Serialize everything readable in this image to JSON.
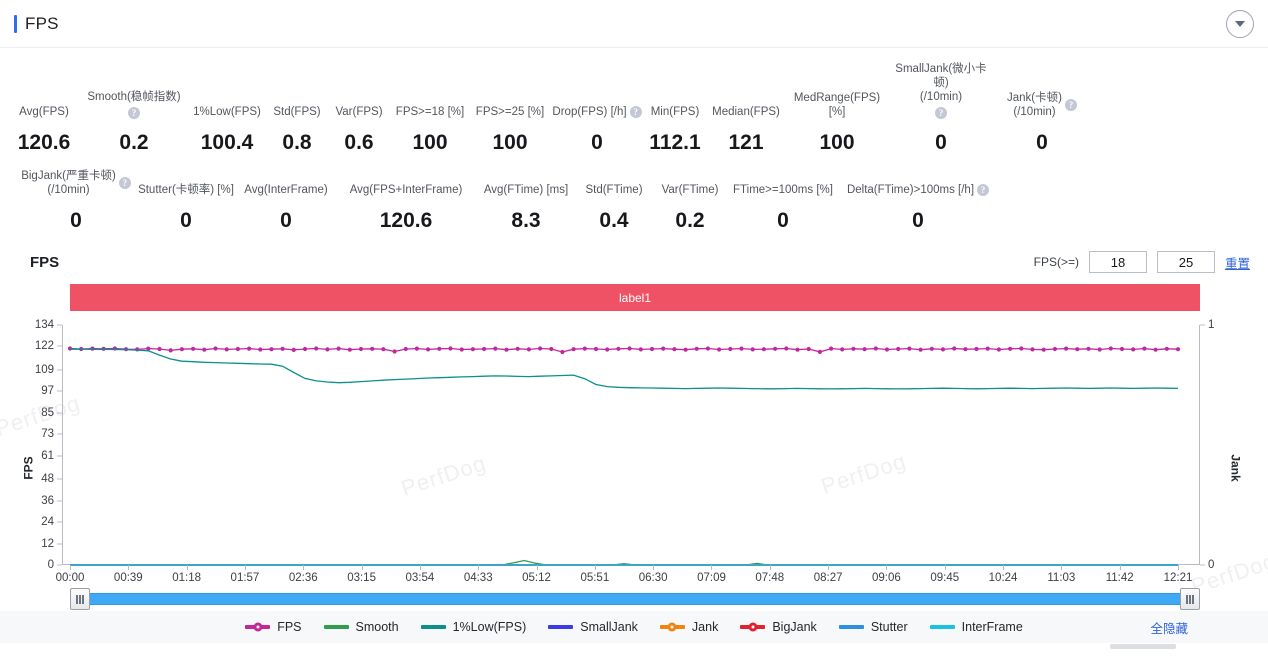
{
  "header": {
    "title": "FPS",
    "collapse_icon": "chevron-down-icon",
    "accent_color": "#2f6fe4"
  },
  "watermark": "PerfDog",
  "metrics_rows": [
    [
      {
        "label": "Avg(FPS)",
        "value": "120.6",
        "help": false
      },
      {
        "label": "Smooth(稳帧指数)",
        "value": "0.2",
        "help": true
      },
      {
        "label": "1%Low(FPS)",
        "value": "100.4",
        "help": false
      },
      {
        "label": "Std(FPS)",
        "value": "0.8",
        "help": false
      },
      {
        "label": "Var(FPS)",
        "value": "0.6",
        "help": false
      },
      {
        "label": "FPS>=18 [%]",
        "value": "100",
        "help": false
      },
      {
        "label": "FPS>=25 [%]",
        "value": "100",
        "help": false
      },
      {
        "label": "Drop(FPS) [/h]",
        "value": "0",
        "help": true
      },
      {
        "label": "Min(FPS)",
        "value": "112.1",
        "help": false
      },
      {
        "label": "Median(FPS)",
        "value": "121",
        "help": false
      },
      {
        "label": "MedRange(FPS)[%]",
        "value": "100",
        "help": false
      },
      {
        "label": "SmallJank(微小卡顿)\n(/10min)",
        "value": "0",
        "help": true
      },
      {
        "label": "Jank(卡顿)\n(/10min)",
        "value": "0",
        "help": true
      }
    ],
    [
      {
        "label": "BigJank(严重卡顿)\n(/10min)",
        "value": "0",
        "help": true
      },
      {
        "label": "Stutter(卡顿率) [%]",
        "value": "0",
        "help": false
      },
      {
        "label": "Avg(InterFrame)",
        "value": "0",
        "help": false
      },
      {
        "label": "Avg(FPS+InterFrame)",
        "value": "120.6",
        "help": false
      },
      {
        "label": "Avg(FTime) [ms]",
        "value": "8.3",
        "help": false
      },
      {
        "label": "Std(FTime)",
        "value": "0.4",
        "help": false
      },
      {
        "label": "Var(FTime)",
        "value": "0.2",
        "help": false
      },
      {
        "label": "FTime>=100ms [%]",
        "value": "0",
        "help": false
      },
      {
        "label": "Delta(FTime)>100ms [/h]",
        "value": "0",
        "help": true
      }
    ]
  ],
  "chart_section": {
    "heading": "FPS",
    "controls": {
      "label": "FPS(>=)",
      "threshold_1": "18",
      "threshold_2": "25",
      "reset_label": "重置"
    },
    "label_bar": "label1",
    "datazoom": {
      "start_percent": 0,
      "end_percent": 100
    }
  },
  "chart_data": {
    "type": "line",
    "title": "FPS",
    "xlabel": "",
    "ylabel": "FPS",
    "y2label": "Jank",
    "grid": false,
    "legend_position": "bottom",
    "annotation_bar": "label1",
    "x_ticks": [
      "00:00",
      "00:39",
      "01:18",
      "01:57",
      "02:36",
      "03:15",
      "03:54",
      "04:33",
      "05:12",
      "05:51",
      "06:30",
      "07:09",
      "07:48",
      "08:27",
      "09:06",
      "09:45",
      "10:24",
      "11:03",
      "11:42",
      "12:21"
    ],
    "y_ticks": [
      0,
      12,
      24,
      36,
      48,
      61,
      73,
      85,
      97,
      109,
      122,
      134
    ],
    "ylim": [
      0,
      134
    ],
    "y2_ticks": [
      0,
      1
    ],
    "y2lim": [
      0,
      1
    ],
    "series": [
      {
        "name": "FPS",
        "color": "#c2279b",
        "axis": "left",
        "marker": "circle",
        "values": [
          120.9,
          120.6,
          120.8,
          120.7,
          120.9,
          120.5,
          120.4,
          120.8,
          120.6,
          119.8,
          120.5,
          120.7,
          120.2,
          120.9,
          120.4,
          120.6,
          120.8,
          120.3,
          120.5,
          120.7,
          120.1,
          120.6,
          120.9,
          120.4,
          120.8,
          120.2,
          120.6,
          120.7,
          120.5,
          119.2,
          120.6,
          120.8,
          120.4,
          120.7,
          120.9,
          120.3,
          120.5,
          120.6,
          120.8,
          120.2,
          120.7,
          120.4,
          120.9,
          120.6,
          118.9,
          120.5,
          120.8,
          120.6,
          120.3,
          120.7,
          120.9,
          120.4,
          120.6,
          120.8,
          120.5,
          120.2,
          120.7,
          120.9,
          120.3,
          120.6,
          120.8,
          120.4,
          120.5,
          120.7,
          120.9,
          120.2,
          120.6,
          119.0,
          120.8,
          120.4,
          120.7,
          120.5,
          120.9,
          120.3,
          120.6,
          120.8,
          120.2,
          120.7,
          120.4,
          120.9,
          120.5,
          120.6,
          120.8,
          120.3,
          120.7,
          120.9,
          120.4,
          120.2,
          120.6,
          120.8,
          120.5,
          120.7,
          120.3,
          120.9,
          120.6,
          120.4,
          120.8,
          120.2,
          120.7,
          120.5
        ]
      },
      {
        "name": "Smooth",
        "color": "#2f9e4f",
        "axis": "left",
        "values": [
          0,
          0,
          0,
          0,
          0,
          0,
          0,
          0,
          0,
          0,
          0,
          0,
          0,
          0,
          0,
          0,
          0,
          0,
          0,
          0,
          0,
          0,
          0,
          0,
          0,
          0,
          0,
          0,
          0,
          0,
          0,
          0,
          0,
          0,
          0,
          0,
          0,
          0,
          0,
          0,
          1.2,
          2.5,
          1.0,
          0,
          0,
          0,
          0,
          0,
          0,
          0,
          0.8,
          0,
          0,
          0,
          0,
          0,
          0,
          0,
          0,
          0,
          0,
          0,
          0.9,
          0,
          0,
          0,
          0,
          0,
          0,
          0,
          0,
          0,
          0,
          0,
          0,
          0,
          0,
          0,
          0,
          0,
          0,
          0,
          0,
          0,
          0,
          0,
          0,
          0,
          0,
          0,
          0,
          0,
          0,
          0,
          0,
          0,
          0,
          0,
          0,
          0,
          0
        ]
      },
      {
        "name": "1%Low(FPS)",
        "color": "#0b8f8f",
        "axis": "left",
        "values": [
          120.5,
          120.5,
          120.4,
          120.4,
          120.3,
          120.2,
          120.0,
          119.6,
          117.2,
          115.0,
          113.8,
          113.5,
          113.2,
          113.0,
          112.8,
          112.6,
          112.4,
          112.2,
          112.1,
          111.0,
          107.5,
          104.2,
          102.8,
          102.2,
          101.8,
          102.0,
          102.4,
          102.8,
          103.2,
          103.5,
          103.8,
          104.1,
          104.4,
          104.6,
          104.8,
          105.0,
          105.2,
          105.4,
          105.6,
          105.5,
          105.3,
          105.2,
          105.4,
          105.6,
          105.8,
          106.0,
          104.0,
          100.8,
          99.6,
          99.2,
          99.0,
          98.9,
          98.8,
          98.7,
          98.6,
          98.5,
          98.6,
          98.7,
          98.8,
          98.7,
          98.6,
          98.5,
          98.4,
          98.4,
          98.5,
          98.6,
          98.5,
          98.4,
          98.3,
          98.4,
          98.5,
          98.6,
          98.5,
          98.4,
          98.3,
          98.4,
          98.5,
          98.6,
          98.7,
          98.6,
          98.5,
          98.4,
          98.5,
          98.6,
          98.7,
          98.6,
          98.5,
          98.6,
          98.7,
          98.8,
          98.7,
          98.6,
          98.7,
          98.8,
          98.7,
          98.6,
          98.7,
          98.8,
          98.7,
          98.6
        ]
      },
      {
        "name": "SmallJank",
        "color": "#3b3ce8",
        "axis": "right",
        "values": [
          0,
          0,
          0,
          0,
          0,
          0,
          0,
          0,
          0,
          0,
          0,
          0,
          0,
          0,
          0,
          0,
          0,
          0,
          0,
          0,
          0,
          0,
          0,
          0,
          0,
          0,
          0,
          0,
          0,
          0,
          0,
          0,
          0,
          0,
          0,
          0,
          0,
          0,
          0,
          0,
          0,
          0,
          0,
          0,
          0,
          0,
          0,
          0,
          0,
          0,
          0,
          0,
          0,
          0,
          0,
          0,
          0,
          0,
          0,
          0,
          0,
          0,
          0,
          0,
          0,
          0,
          0,
          0,
          0,
          0,
          0,
          0,
          0,
          0,
          0,
          0,
          0,
          0,
          0,
          0,
          0,
          0,
          0,
          0,
          0,
          0,
          0,
          0,
          0,
          0,
          0,
          0,
          0,
          0,
          0,
          0,
          0,
          0,
          0,
          0
        ]
      },
      {
        "name": "Jank",
        "color": "#f4830e",
        "axis": "right",
        "values": [
          0,
          0,
          0,
          0,
          0,
          0,
          0,
          0,
          0,
          0,
          0,
          0,
          0,
          0,
          0,
          0,
          0,
          0,
          0,
          0,
          0,
          0,
          0,
          0,
          0,
          0,
          0,
          0,
          0,
          0,
          0,
          0,
          0,
          0,
          0,
          0,
          0,
          0,
          0,
          0,
          0,
          0,
          0,
          0,
          0,
          0,
          0,
          0,
          0,
          0,
          0,
          0,
          0,
          0,
          0,
          0,
          0,
          0,
          0,
          0,
          0,
          0,
          0,
          0,
          0,
          0,
          0,
          0,
          0,
          0,
          0,
          0,
          0,
          0,
          0,
          0,
          0,
          0,
          0,
          0,
          0,
          0,
          0,
          0,
          0,
          0,
          0,
          0,
          0,
          0,
          0,
          0,
          0,
          0,
          0,
          0,
          0,
          0,
          0,
          0
        ]
      },
      {
        "name": "BigJank",
        "color": "#e1222e",
        "axis": "right",
        "marker": "circle",
        "values": [
          0,
          0,
          0,
          0,
          0,
          0,
          0,
          0,
          0,
          0,
          0,
          0,
          0,
          0,
          0,
          0,
          0,
          0,
          0,
          0,
          0,
          0,
          0,
          0,
          0,
          0,
          0,
          0,
          0,
          0,
          0,
          0,
          0,
          0,
          0,
          0,
          0,
          0,
          0,
          0,
          0,
          0,
          0,
          0,
          0,
          0,
          0,
          0,
          0,
          0,
          0,
          0,
          0,
          0,
          0,
          0,
          0,
          0,
          0,
          0,
          0,
          0,
          0,
          0,
          0,
          0,
          0,
          0,
          0,
          0,
          0,
          0,
          0,
          0,
          0,
          0,
          0,
          0,
          0,
          0,
          0,
          0,
          0,
          0,
          0,
          0,
          0,
          0,
          0,
          0,
          0,
          0,
          0,
          0,
          0,
          0,
          0,
          0,
          0,
          0
        ]
      },
      {
        "name": "Stutter",
        "color": "#2e8fe0",
        "axis": "right",
        "values": [
          0,
          0,
          0,
          0,
          0,
          0,
          0,
          0,
          0,
          0,
          0,
          0,
          0,
          0,
          0,
          0,
          0,
          0,
          0,
          0,
          0,
          0,
          0,
          0,
          0,
          0,
          0,
          0,
          0,
          0,
          0,
          0,
          0,
          0,
          0,
          0,
          0,
          0,
          0,
          0,
          0,
          0,
          0,
          0,
          0,
          0,
          0,
          0,
          0,
          0,
          0,
          0,
          0,
          0,
          0,
          0,
          0,
          0,
          0,
          0,
          0,
          0,
          0,
          0,
          0,
          0,
          0,
          0,
          0,
          0,
          0,
          0,
          0,
          0,
          0,
          0,
          0,
          0,
          0,
          0,
          0,
          0,
          0,
          0,
          0,
          0,
          0,
          0,
          0,
          0,
          0,
          0,
          0,
          0,
          0,
          0,
          0,
          0,
          0,
          0
        ]
      },
      {
        "name": "InterFrame",
        "color": "#17c3e0",
        "axis": "left",
        "values": [
          0,
          0,
          0,
          0,
          0,
          0,
          0,
          0,
          0,
          0,
          0,
          0,
          0,
          0,
          0,
          0,
          0,
          0,
          0,
          0,
          0,
          0,
          0,
          0,
          0,
          0,
          0,
          0,
          0,
          0,
          0,
          0,
          0,
          0,
          0,
          0,
          0,
          0,
          0,
          0,
          0,
          0,
          0,
          0,
          0,
          0,
          0,
          0,
          0,
          0,
          0,
          0,
          0,
          0,
          0,
          0,
          0,
          0,
          0,
          0,
          0,
          0,
          0,
          0,
          0,
          0,
          0,
          0,
          0,
          0,
          0,
          0,
          0,
          0,
          0,
          0,
          0,
          0,
          0,
          0,
          0,
          0,
          0,
          0,
          0,
          0,
          0,
          0,
          0,
          0,
          0,
          0,
          0,
          0,
          0,
          0,
          0,
          0,
          0,
          0
        ]
      }
    ]
  },
  "legend": {
    "items": [
      {
        "name": "FPS",
        "color": "#c2279b",
        "marker": "line-dot"
      },
      {
        "name": "Smooth",
        "color": "#2f9e4f",
        "marker": "line"
      },
      {
        "name": "1%Low(FPS)",
        "color": "#0b8f8f",
        "marker": "line"
      },
      {
        "name": "SmallJank",
        "color": "#3b3ce8",
        "marker": "line"
      },
      {
        "name": "Jank",
        "color": "#f4830e",
        "marker": "line-dot"
      },
      {
        "name": "BigJank",
        "color": "#e1222e",
        "marker": "line-dot"
      },
      {
        "name": "Stutter",
        "color": "#2e8fe0",
        "marker": "line"
      },
      {
        "name": "InterFrame",
        "color": "#17c3e0",
        "marker": "line"
      }
    ],
    "hide_all_label": "全隐藏"
  }
}
